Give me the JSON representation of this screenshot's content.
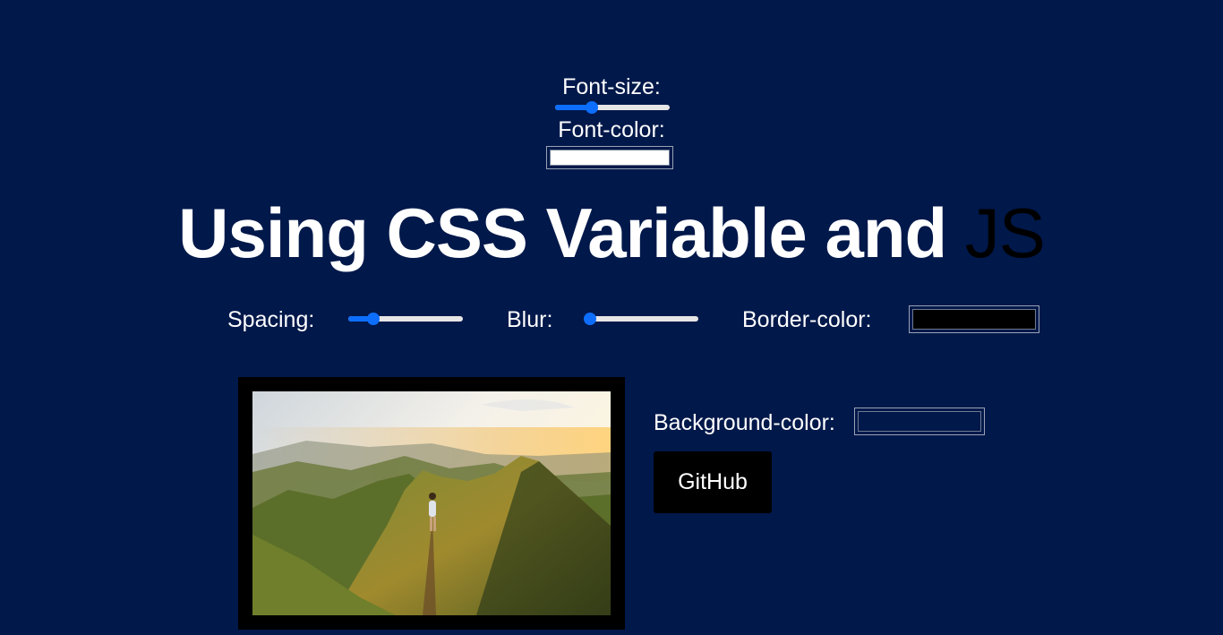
{
  "controls": {
    "font_size": {
      "label": "Font-size:",
      "value": 0.3
    },
    "font_color": {
      "label": "Font-color:",
      "value": "#ffffff"
    },
    "spacing": {
      "label": "Spacing:",
      "value": 0.18
    },
    "blur": {
      "label": "Blur:",
      "value": 0.0
    },
    "border_color": {
      "label": "Border-color:",
      "value": "#000000"
    },
    "background_color": {
      "label": "Background-color:",
      "value": "#00184a"
    }
  },
  "heading": {
    "main": "Using CSS Variable and ",
    "highlight": "JS"
  },
  "image": {
    "icon": "mountain-landscape-photo"
  },
  "github": {
    "label": "GitHub"
  },
  "colors": {
    "page_bg": "#00184a",
    "accent": "#0d6efd",
    "text": "#ffffff"
  }
}
